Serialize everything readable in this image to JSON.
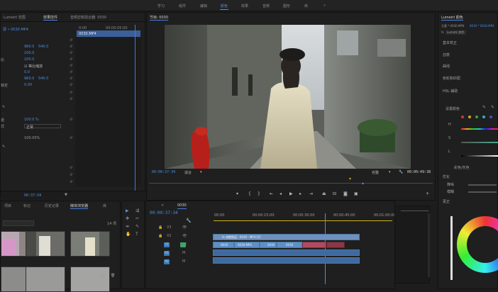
{
  "workspaces": {
    "items": [
      "学习",
      "组件",
      "编辑",
      "颜色",
      "效果",
      "音频",
      "图形",
      "库"
    ],
    "active": 3,
    "more": "»"
  },
  "effect_controls": {
    "tabs": [
      "Lumetri 范围",
      "效果控件",
      "音频剪辑混合器: 0030"
    ],
    "source_label": "源 • 0030.MP4",
    "clip_label": "0030.MP4",
    "ruler_start": "0:00",
    "ruler_mid": "00:00:05:00",
    "rows": [
      {
        "name": "",
        "value": "",
        "value2": ""
      },
      {
        "name": "",
        "value": "960.0",
        "value2": "540.0"
      },
      {
        "name": "",
        "value": "100.0",
        "value2": ""
      },
      {
        "name": "比",
        "value": "100.0",
        "value2": ""
      },
      {
        "name": "",
        "value": "☑ 等比缩放",
        "value2": ""
      },
      {
        "name": "",
        "value": "0.0",
        "value2": ""
      },
      {
        "name": "",
        "value": "960.0",
        "value2": "540.0"
      },
      {
        "name": "锁定",
        "value": "0.00",
        "value2": ""
      },
      {
        "name": "",
        "value": "",
        "value2": ""
      },
      {
        "name": "",
        "value": "",
        "value2": ""
      },
      {
        "name": "",
        "value": "",
        "value2": ""
      },
      {
        "name": "",
        "value": "",
        "value2": ""
      },
      {
        "name": "",
        "value": "",
        "value2": ""
      },
      {
        "name": "道",
        "value": "100.0 %",
        "value2": ""
      },
      {
        "name": "式",
        "value": "正常",
        "value2": ""
      },
      {
        "name": "",
        "value": "",
        "value2": ""
      },
      {
        "name": "",
        "value": "100.00%",
        "value2": ""
      },
      {
        "name": "",
        "value": "",
        "value2": ""
      }
    ],
    "timecode": "00:37:34"
  },
  "program_monitor": {
    "tab": "节目: 0030",
    "timecode": "00:00:37:34",
    "fit": "适合",
    "quality": "完整",
    "duration": "00:00:49:38"
  },
  "project": {
    "tabs": [
      "项目",
      "标记",
      "历史记录",
      "媒体浏览器",
      "库"
    ],
    "count": "14 项",
    "thumbs": [
      {
        "label": "",
        "dur": ""
      },
      {
        "label": "",
        "dur": ""
      },
      {
        "label": "",
        "dur": ""
      },
      {
        "label": "",
        "dur": ""
      },
      {
        "label": "",
        "dur": ""
      },
      {
        "label": "",
        "dur": ""
      }
    ]
  },
  "timeline": {
    "close": "×",
    "tab": "0030",
    "timecode": "00:00:37:34",
    "ruler": [
      "00:00",
      "00:00:15:00",
      "00:00:30:00",
      "00:00:45:00",
      "00:01:00:00"
    ],
    "tracks": [
      {
        "name": "V3",
        "lock": "🔒",
        "eye": "👁"
      },
      {
        "name": "V2",
        "lock": "🔒",
        "eye": "👁"
      },
      {
        "name": "V1",
        "lock": "🔒",
        "eye": "👁"
      },
      {
        "name": "A1",
        "lock": "🔒",
        "eye": "M"
      },
      {
        "name": "A2",
        "lock": "🔒",
        "eye": "M"
      },
      {
        "name": "A3",
        "lock": "🔒",
        "eye": "M"
      }
    ],
    "clip_v2": "fx 调整图层 · 0030 · MP4 [V]",
    "clip_v1_a": "0030",
    "clip_v1_b": "0030.MP4",
    "clip_v1_c": "0030",
    "clip_v1_d": "0030"
  },
  "lumetri": {
    "title": "Lumetri 颜色",
    "source": "主要 * 0030.MP4",
    "target": "0030 * 0030.MP4",
    "fx_label": "fx",
    "fx_name": "Lumetri 颜色",
    "sections": [
      "基本校正",
      "创意",
      "曲线",
      "色轮和匹配",
      "HSL 辅助",
      "晕影"
    ],
    "hsl_label": "设置颜色",
    "sliders": [
      "H",
      "S",
      "L"
    ],
    "color_label": "彩色/灰色",
    "refine": "优化",
    "denoise": "降噪",
    "blur": "模糊",
    "correct": "更正"
  },
  "colors": {
    "accent": "#4d8fe6",
    "clip": "#5f8fc9",
    "audio": "#3f6aa0",
    "green": "#2f9e57",
    "yellow": "#d9b520"
  },
  "icons": [
    "play-icon",
    "step-back-icon",
    "step-forward-icon",
    "wrench-icon",
    "camera-icon",
    "plus-icon",
    "selection-tool-icon",
    "razor-tool-icon",
    "hand-tool-icon",
    "type-tool-icon",
    "pen-tool-icon",
    "eyedropper-icon"
  ]
}
